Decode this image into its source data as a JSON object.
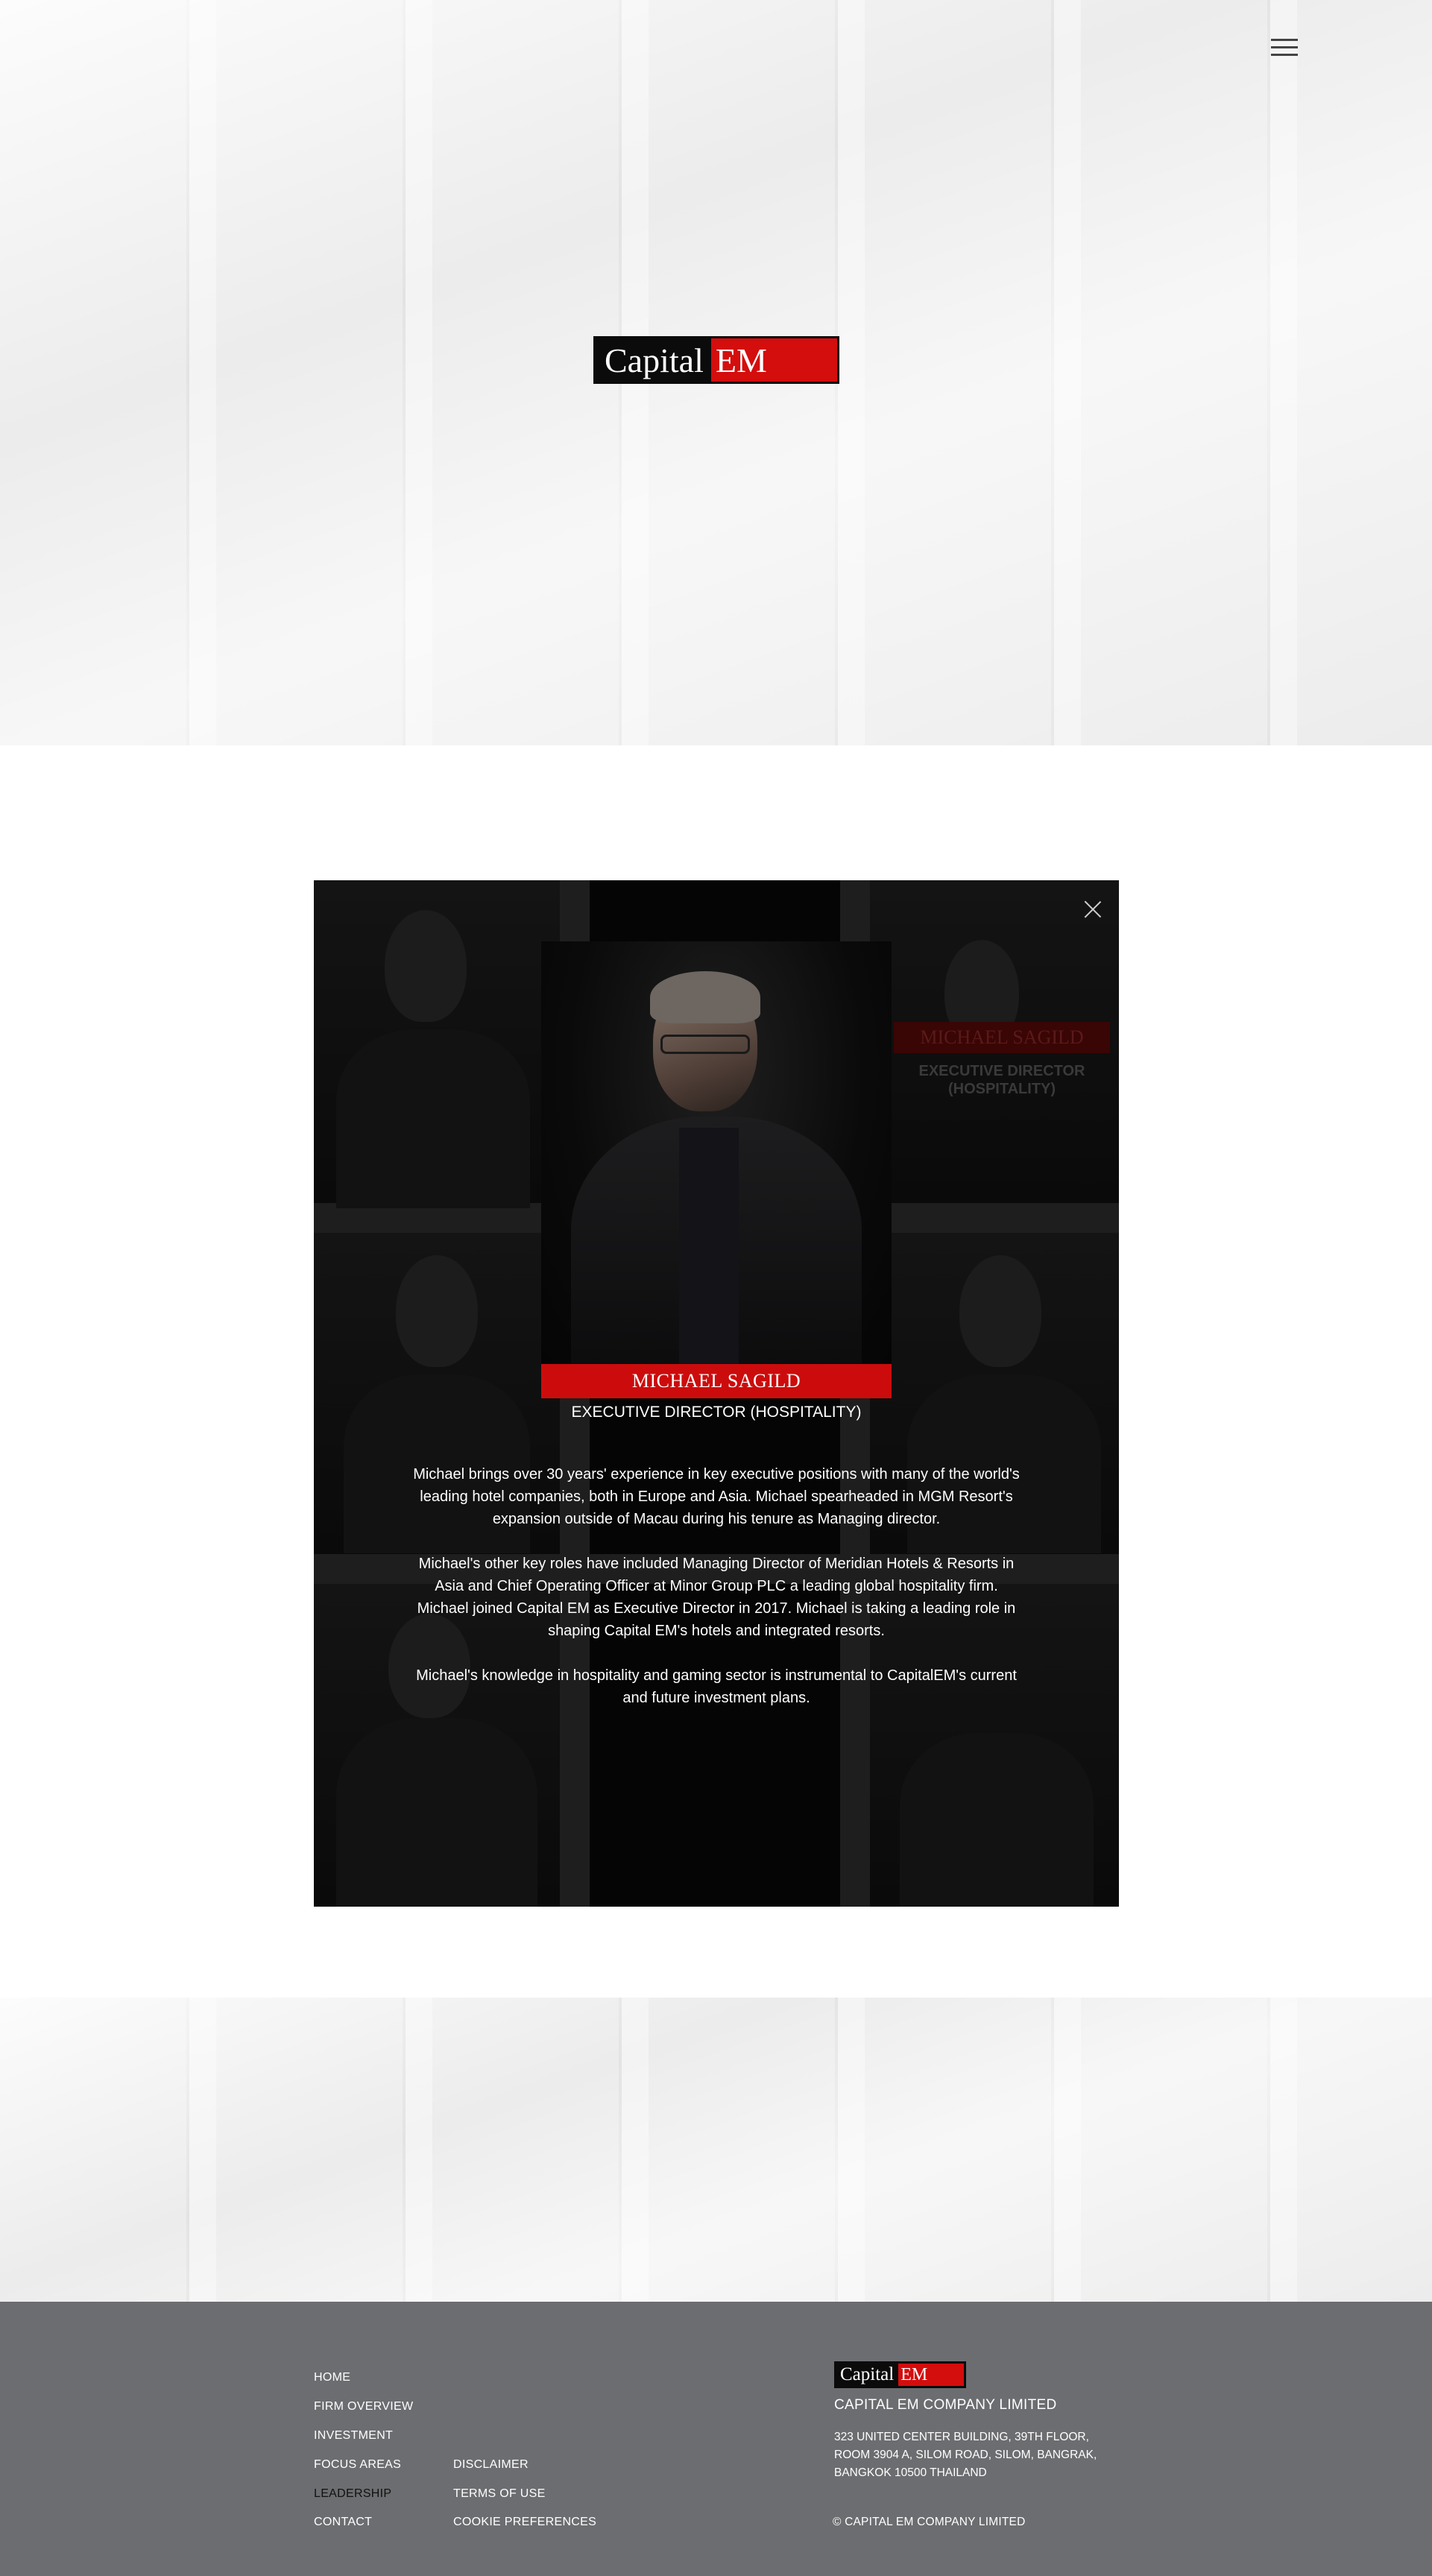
{
  "header": {
    "menu_icon": "hamburger-menu-icon",
    "logo": {
      "word": "Capital",
      "accent": "EM"
    }
  },
  "modal": {
    "close_icon": "close-icon",
    "name": "MICHAEL SAGILD",
    "role": "EXECUTIVE DIRECTOR (HOSPITALITY)",
    "bio": [
      "Michael brings over 30 years' experience in key executive positions with many of the world's leading hotel companies, both in Europe and Asia. Michael spearheaded in MGM Resort's expansion outside of Macau during his tenure as Managing director.",
      "Michael's other key roles have included Managing Director of Meridian Hotels & Resorts in Asia and Chief Operating Officer at Minor Group PLC a leading global hospitality firm. Michael joined Capital EM as Executive Director in 2017. Michael is taking a leading role in shaping Capital EM's hotels and integrated resorts.",
      "Michael's knowledge in hospitality and gaming sector is instrumental to CapitalEM's current and future investment plans."
    ],
    "background_card": {
      "name": "MICHAEL SAGILD",
      "role_line1": "EXECUTIVE DIRECTOR",
      "role_line2": "(HOSPITALITY)"
    }
  },
  "footer": {
    "nav_col1": [
      "HOME",
      "FIRM OVERVIEW",
      "INVESTMENT",
      "FOCUS AREAS",
      "LEADERSHIP",
      "CONTACT"
    ],
    "nav_col2": [
      "DISCLAIMER",
      "TERMS OF USE",
      "COOKIE PREFERENCES"
    ],
    "active_item": "LEADERSHIP",
    "logo": {
      "word": "Capital",
      "accent": "EM"
    },
    "company_name": "CAPITAL EM COMPANY LIMITED",
    "address_lines": [
      "323 UNITED CENTER BUILDING, 39TH FLOOR,",
      "ROOM 3904 A, SILOM ROAD, SILOM, BANGRAK,",
      "BANGKOK 10500 THAILAND"
    ],
    "copyright": "© CAPITAL EM COMPANY LIMITED"
  },
  "colors": {
    "brand_red": "#cc0c0c",
    "footer_bg": "#6c6d70",
    "modal_bg": "#050505"
  }
}
